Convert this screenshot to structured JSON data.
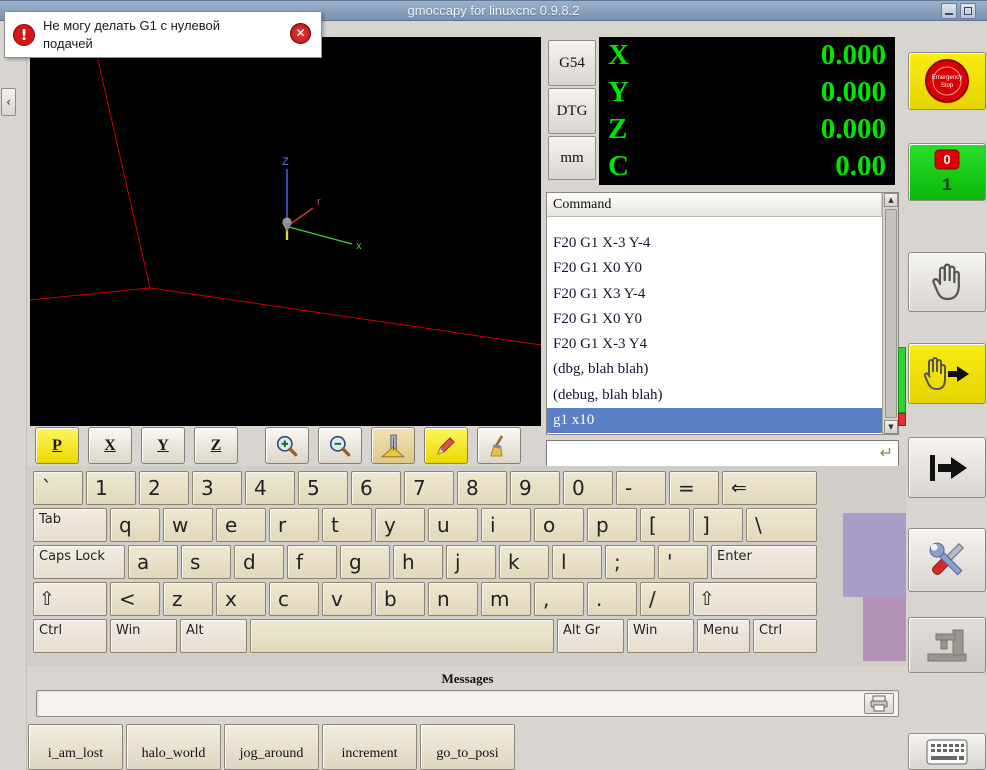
{
  "window": {
    "title": "gmoccapy for linuxcnc 0.9.8.2",
    "stray_top": "4",
    "stray_left": "1",
    "collapse_arrow": "‹"
  },
  "error_popup": {
    "icon_glyph": "!",
    "line1": "Не могу делать G1 с нулевой",
    "line2": "подачей",
    "close_glyph": "✕"
  },
  "dro": {
    "ref_button": "G54",
    "dtg_button": "DTG",
    "units_button": "mm",
    "axes": [
      {
        "name": "X",
        "value": "0.000"
      },
      {
        "name": "Y",
        "value": "0.000"
      },
      {
        "name": "Z",
        "value": "0.000"
      },
      {
        "name": "C",
        "value": "0.00"
      }
    ]
  },
  "preview": {
    "axis_z": "Z",
    "axis_x": "x",
    "axis_r": "r",
    "toolbar": {
      "p": "P",
      "x": "X",
      "y": "Y",
      "z": "Z"
    }
  },
  "mdi": {
    "header": "Command",
    "history": [
      "F20 G1 X-3 Y-4",
      "F20 G1 X0 Y0",
      "F20 G1 X3 Y-4",
      "F20 G1 X0 Y0",
      "F20 G1 X-3 Y4",
      "(dbg, blah blah)",
      "(debug, blah blah)",
      "g1 x10"
    ],
    "selected_index": 7,
    "input_value": "",
    "enter_icon": "↵",
    "scroll_up": "▲",
    "scroll_down": "▼"
  },
  "keyboard": {
    "rows": [
      [
        "`",
        "1",
        "2",
        "3",
        "4",
        "5",
        "6",
        "7",
        "8",
        "9",
        "0",
        "-",
        "=",
        "⇐"
      ],
      [
        "Tab",
        "q",
        "w",
        "e",
        "r",
        "t",
        "y",
        "u",
        "i",
        "o",
        "p",
        "[",
        "]",
        "\\"
      ],
      [
        "Caps Lock",
        "a",
        "s",
        "d",
        "f",
        "g",
        "h",
        "j",
        "k",
        "l",
        ";",
        "'",
        "Enter"
      ],
      [
        "⇧",
        "<",
        "z",
        "x",
        "c",
        "v",
        "b",
        "n",
        "m",
        ",",
        ".",
        "/",
        "⇧"
      ],
      [
        "Ctrl",
        "Win",
        "Alt",
        "",
        "Alt Gr",
        "Win",
        "Menu",
        "Ctrl"
      ]
    ]
  },
  "messages": {
    "title": "Messages"
  },
  "macros": [
    "i_am_lost",
    "halo_world",
    "jog_around",
    "increment",
    "go_to_posi"
  ],
  "sidebar": {
    "estop_line1": "Emergency",
    "estop_line2": "Stop",
    "power_off": "0",
    "power_on": "1"
  },
  "colors": {
    "dro_value": "#00e600",
    "selected_row": "#5a7fc5",
    "estop_red": "#d80000",
    "power_green": "#18cf18",
    "button_yellow": "#f2e50a",
    "titlebar_blue": "#7a93b3"
  }
}
